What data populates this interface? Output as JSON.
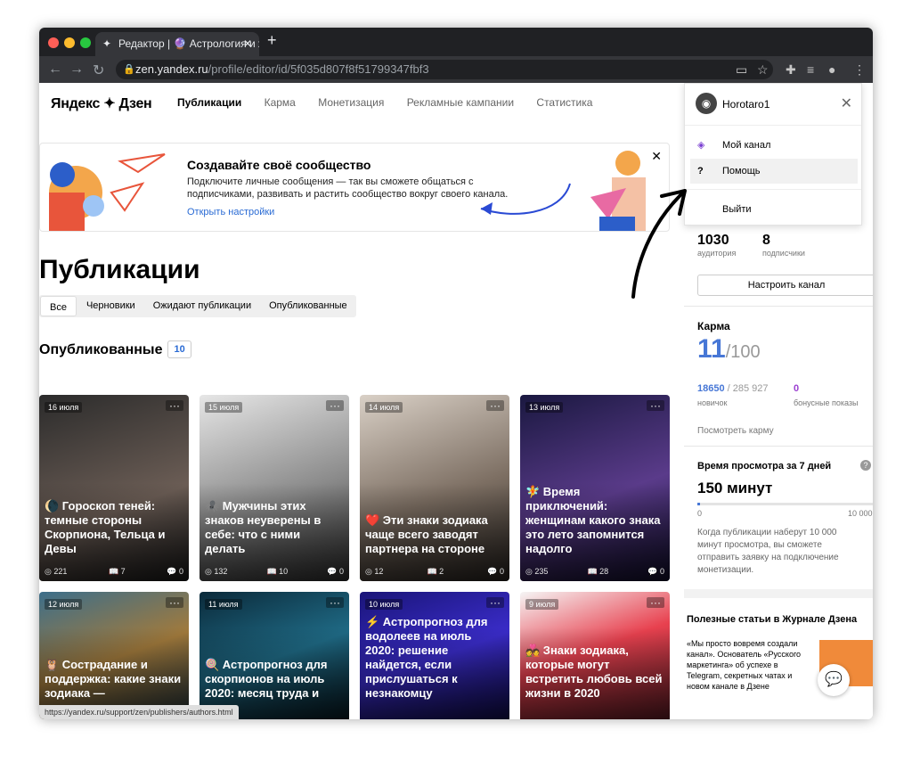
{
  "browser": {
    "tab_title": "Редактор | 🔮 Астрология и ж",
    "url_host": "zen.yandex.ru",
    "url_path": "/profile/editor/id/5f035d807f8f51799347fbf3",
    "status_url": "https://yandex.ru/support/zen/publishers/authors.html"
  },
  "header": {
    "logo": "Яндекс ✦ Дзен",
    "nav": [
      "Публикации",
      "Карма",
      "Монетизация",
      "Рекламные кампании",
      "Статистика"
    ]
  },
  "banner": {
    "title": "Создавайте своё сообщество",
    "text": "Подключите личные сообщения — так вы сможете общаться с подписчиками, развивать и растить сообщество вокруг своего канала.",
    "link": "Открыть настройки"
  },
  "main": {
    "title": "Публикации",
    "filters": [
      "Все",
      "Черновики",
      "Ожидают публикации",
      "Опубликованные"
    ],
    "section": "Опубликованные",
    "count": "10"
  },
  "cards": [
    {
      "date": "16 июля",
      "title": "🌘 Гороскоп теней: темные стороны Скорпиона, Тельца и Девы",
      "views": "221",
      "reads": "7",
      "comments": "0"
    },
    {
      "date": "15 июля",
      "title": "🕷️ Мужчины этих знаков неуверены в себе: что с ними делать",
      "views": "132",
      "reads": "10",
      "comments": "0"
    },
    {
      "date": "14 июля",
      "title": "❤️ Эти знаки зодиака чаще всего заводят партнера на стороне",
      "views": "12",
      "reads": "2",
      "comments": "0"
    },
    {
      "date": "13 июля",
      "title": "🧚 Время приключений: женщинам какого знака это лето запомнится надолго",
      "views": "235",
      "reads": "28",
      "comments": "0"
    },
    {
      "date": "12 июля",
      "title": "🦉 Сострадание и поддержка: какие знаки зодиака —",
      "views": "",
      "reads": "",
      "comments": ""
    },
    {
      "date": "11 июля",
      "title": "🍭 Астропрогноз для скорпионов на июль 2020: месяц труда и",
      "views": "",
      "reads": "",
      "comments": ""
    },
    {
      "date": "10 июля",
      "title": "⚡ Астропрогноз для водолеев на июль 2020: решение найдется, если прислушаться к незнакомцу",
      "views": "",
      "reads": "",
      "comments": ""
    },
    {
      "date": "9 июля",
      "title": "💑 Знаки зодиака, которые могут встретить любовь всей жизни в 2020",
      "views": "",
      "reads": "",
      "comments": ""
    }
  ],
  "menu": {
    "username": "Horotaro1",
    "items": [
      "Мой канал",
      "Помощь",
      "Выйти"
    ]
  },
  "sidebar": {
    "audience": "1030",
    "audience_label": "аудитория",
    "subs": "8",
    "subs_label": "подписчики",
    "setup": "Настроить канал",
    "karma_title": "Карма",
    "karma_value": "11",
    "karma_max": "/100",
    "karma_pts": "18650",
    "karma_pts_max": "/ 285 927",
    "karma_rank": "новичок",
    "bonus": "0",
    "bonus_label": "бонусные показы",
    "karma_link": "Посмотреть карму",
    "watch_title": "Время просмотра за 7 дней",
    "watch_value": "150 минут",
    "watch_min": "0",
    "watch_max": "10 000",
    "watch_progress": 0.015,
    "watch_text": "Когда публикации наберут 10 000 минут просмотра, вы сможете отправить заявку на подключение монетизации.",
    "journal_title": "Полезные статьи в Журнале Дзена",
    "journal_text": "«Мы просто вовремя создали канал». Основатель «Русского маркетинга» об успехе в Telegram, секретных чатах и новом канале в Дзене"
  },
  "colors": {
    "accent": "#2a6bd4",
    "karma": "#4777d6",
    "bonus": "#9b3fd1"
  }
}
